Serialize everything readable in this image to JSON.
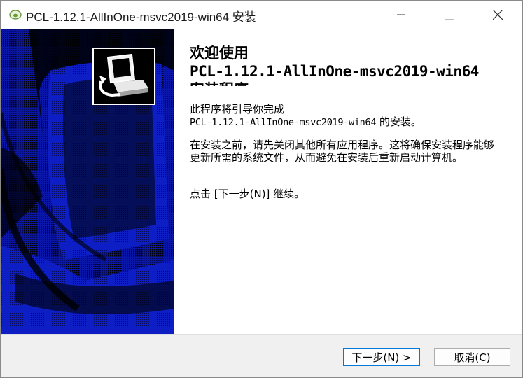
{
  "window": {
    "title": "PCL-1.12.1-AllInOne-msvc2019-win64 安装"
  },
  "content": {
    "heading_line1": "欢迎使用",
    "heading_line2": "PCL-1.12.1-AllInOne-msvc2019-win64",
    "heading_line3": "安装程序",
    "intro_prefix": "此程序将引导你完成",
    "intro_product": "PCL-1.12.1-AllInOne-msvc2019-win64",
    "intro_suffix": " 的安装。",
    "advice": "在安装之前，请先关闭其他所有应用程序。这将确保安装程序能够更新所需的系统文件，从而避免在安装后重新启动计算机。",
    "continue": "点击 [下一步(N)] 继续。"
  },
  "footer": {
    "next_label": "下一步(N) >",
    "cancel_label": "取消(C)"
  },
  "icons": {
    "title": "app-icon",
    "minimize": "minimize-icon",
    "maximize": "maximize-icon",
    "close": "close-icon",
    "installer": "installer-computer-icon"
  },
  "colors": {
    "sidepanel_blue": "#0a16a8",
    "accent": "#0078d7"
  }
}
